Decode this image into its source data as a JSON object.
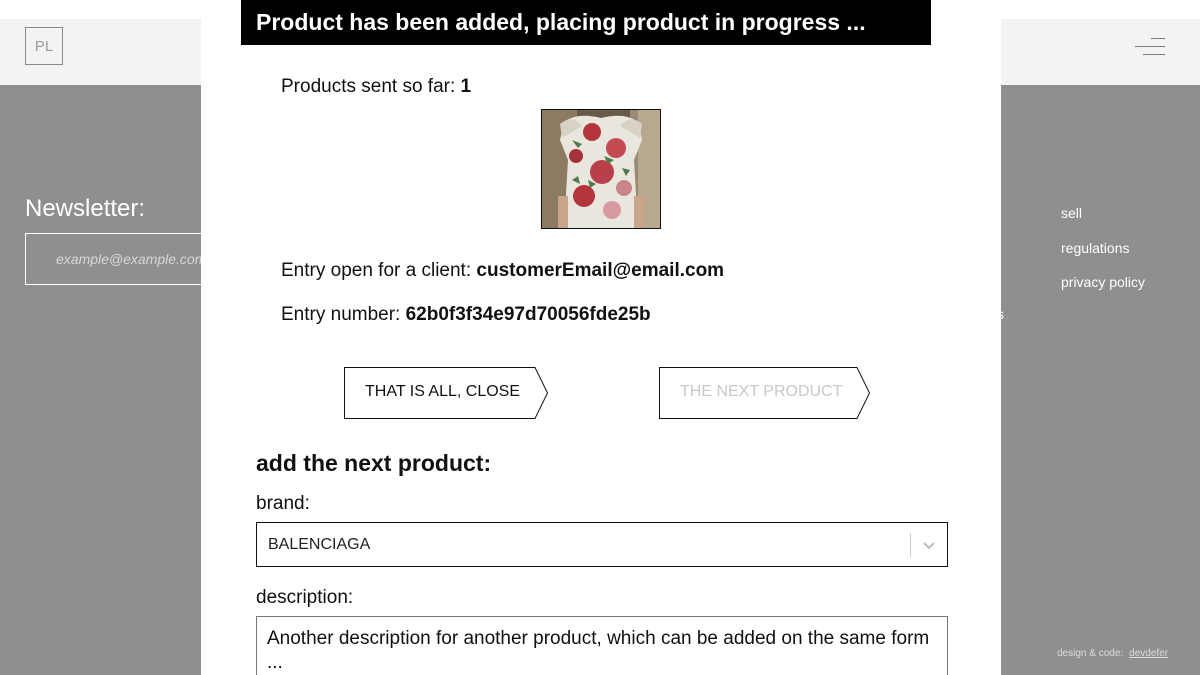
{
  "site": {
    "logo_text": "PL",
    "newsletter_title": "Newsletter:",
    "newsletter_placeholder": "example@example.com",
    "footer_links": [
      "sell",
      "regulations",
      "privacy policy"
    ],
    "stray_text": "s",
    "credit_label": "design & code:",
    "credit_link": "devdefer"
  },
  "modal": {
    "banner": "Product has been added, placing product in progress ...",
    "sent_label": "Products sent so far: ",
    "sent_count": "1",
    "client_label": "Entry open for a client: ",
    "client_email": "customerEmail@email.com",
    "entry_label": "Entry number: ",
    "entry_number": "62b0f3f34e97d70056fde25b",
    "close_button": "THAT IS ALL, CLOSE",
    "next_button": "THE NEXT PRODUCT",
    "next_section_title": "add the next product:",
    "brand_label": "brand:",
    "brand_value": "BALENCIAGA",
    "description_label": "description:",
    "description_value": "Another description for another product, which can be added on the same form ..."
  },
  "colors": {
    "overlay": "#8f8f8f",
    "banner": "#000000",
    "disabled_text": "#c8c8c8"
  }
}
